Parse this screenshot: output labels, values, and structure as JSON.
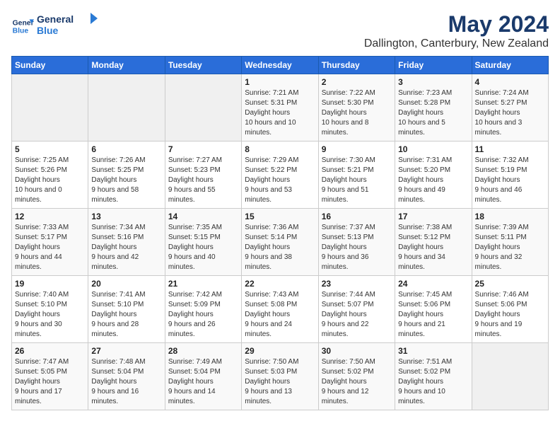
{
  "header": {
    "logo_text_top": "General",
    "logo_text_bottom": "Blue",
    "title": "May 2024",
    "subtitle": "Dallington, Canterbury, New Zealand"
  },
  "weekdays": [
    "Sunday",
    "Monday",
    "Tuesday",
    "Wednesday",
    "Thursday",
    "Friday",
    "Saturday"
  ],
  "weeks": [
    [
      {
        "day": "",
        "empty": true
      },
      {
        "day": "",
        "empty": true
      },
      {
        "day": "",
        "empty": true
      },
      {
        "day": "1",
        "sunrise": "7:21 AM",
        "sunset": "5:31 PM",
        "daylight": "10 hours and 10 minutes."
      },
      {
        "day": "2",
        "sunrise": "7:22 AM",
        "sunset": "5:30 PM",
        "daylight": "10 hours and 8 minutes."
      },
      {
        "day": "3",
        "sunrise": "7:23 AM",
        "sunset": "5:28 PM",
        "daylight": "10 hours and 5 minutes."
      },
      {
        "day": "4",
        "sunrise": "7:24 AM",
        "sunset": "5:27 PM",
        "daylight": "10 hours and 3 minutes."
      }
    ],
    [
      {
        "day": "5",
        "sunrise": "7:25 AM",
        "sunset": "5:26 PM",
        "daylight": "10 hours and 0 minutes."
      },
      {
        "day": "6",
        "sunrise": "7:26 AM",
        "sunset": "5:25 PM",
        "daylight": "9 hours and 58 minutes."
      },
      {
        "day": "7",
        "sunrise": "7:27 AM",
        "sunset": "5:23 PM",
        "daylight": "9 hours and 55 minutes."
      },
      {
        "day": "8",
        "sunrise": "7:29 AM",
        "sunset": "5:22 PM",
        "daylight": "9 hours and 53 minutes."
      },
      {
        "day": "9",
        "sunrise": "7:30 AM",
        "sunset": "5:21 PM",
        "daylight": "9 hours and 51 minutes."
      },
      {
        "day": "10",
        "sunrise": "7:31 AM",
        "sunset": "5:20 PM",
        "daylight": "9 hours and 49 minutes."
      },
      {
        "day": "11",
        "sunrise": "7:32 AM",
        "sunset": "5:19 PM",
        "daylight": "9 hours and 46 minutes."
      }
    ],
    [
      {
        "day": "12",
        "sunrise": "7:33 AM",
        "sunset": "5:17 PM",
        "daylight": "9 hours and 44 minutes."
      },
      {
        "day": "13",
        "sunrise": "7:34 AM",
        "sunset": "5:16 PM",
        "daylight": "9 hours and 42 minutes."
      },
      {
        "day": "14",
        "sunrise": "7:35 AM",
        "sunset": "5:15 PM",
        "daylight": "9 hours and 40 minutes."
      },
      {
        "day": "15",
        "sunrise": "7:36 AM",
        "sunset": "5:14 PM",
        "daylight": "9 hours and 38 minutes."
      },
      {
        "day": "16",
        "sunrise": "7:37 AM",
        "sunset": "5:13 PM",
        "daylight": "9 hours and 36 minutes."
      },
      {
        "day": "17",
        "sunrise": "7:38 AM",
        "sunset": "5:12 PM",
        "daylight": "9 hours and 34 minutes."
      },
      {
        "day": "18",
        "sunrise": "7:39 AM",
        "sunset": "5:11 PM",
        "daylight": "9 hours and 32 minutes."
      }
    ],
    [
      {
        "day": "19",
        "sunrise": "7:40 AM",
        "sunset": "5:10 PM",
        "daylight": "9 hours and 30 minutes."
      },
      {
        "day": "20",
        "sunrise": "7:41 AM",
        "sunset": "5:10 PM",
        "daylight": "9 hours and 28 minutes."
      },
      {
        "day": "21",
        "sunrise": "7:42 AM",
        "sunset": "5:09 PM",
        "daylight": "9 hours and 26 minutes."
      },
      {
        "day": "22",
        "sunrise": "7:43 AM",
        "sunset": "5:08 PM",
        "daylight": "9 hours and 24 minutes."
      },
      {
        "day": "23",
        "sunrise": "7:44 AM",
        "sunset": "5:07 PM",
        "daylight": "9 hours and 22 minutes."
      },
      {
        "day": "24",
        "sunrise": "7:45 AM",
        "sunset": "5:06 PM",
        "daylight": "9 hours and 21 minutes."
      },
      {
        "day": "25",
        "sunrise": "7:46 AM",
        "sunset": "5:06 PM",
        "daylight": "9 hours and 19 minutes."
      }
    ],
    [
      {
        "day": "26",
        "sunrise": "7:47 AM",
        "sunset": "5:05 PM",
        "daylight": "9 hours and 17 minutes."
      },
      {
        "day": "27",
        "sunrise": "7:48 AM",
        "sunset": "5:04 PM",
        "daylight": "9 hours and 16 minutes."
      },
      {
        "day": "28",
        "sunrise": "7:49 AM",
        "sunset": "5:04 PM",
        "daylight": "9 hours and 14 minutes."
      },
      {
        "day": "29",
        "sunrise": "7:50 AM",
        "sunset": "5:03 PM",
        "daylight": "9 hours and 13 minutes."
      },
      {
        "day": "30",
        "sunrise": "7:50 AM",
        "sunset": "5:02 PM",
        "daylight": "9 hours and 12 minutes."
      },
      {
        "day": "31",
        "sunrise": "7:51 AM",
        "sunset": "5:02 PM",
        "daylight": "9 hours and 10 minutes."
      },
      {
        "day": "",
        "empty": true
      }
    ]
  ]
}
